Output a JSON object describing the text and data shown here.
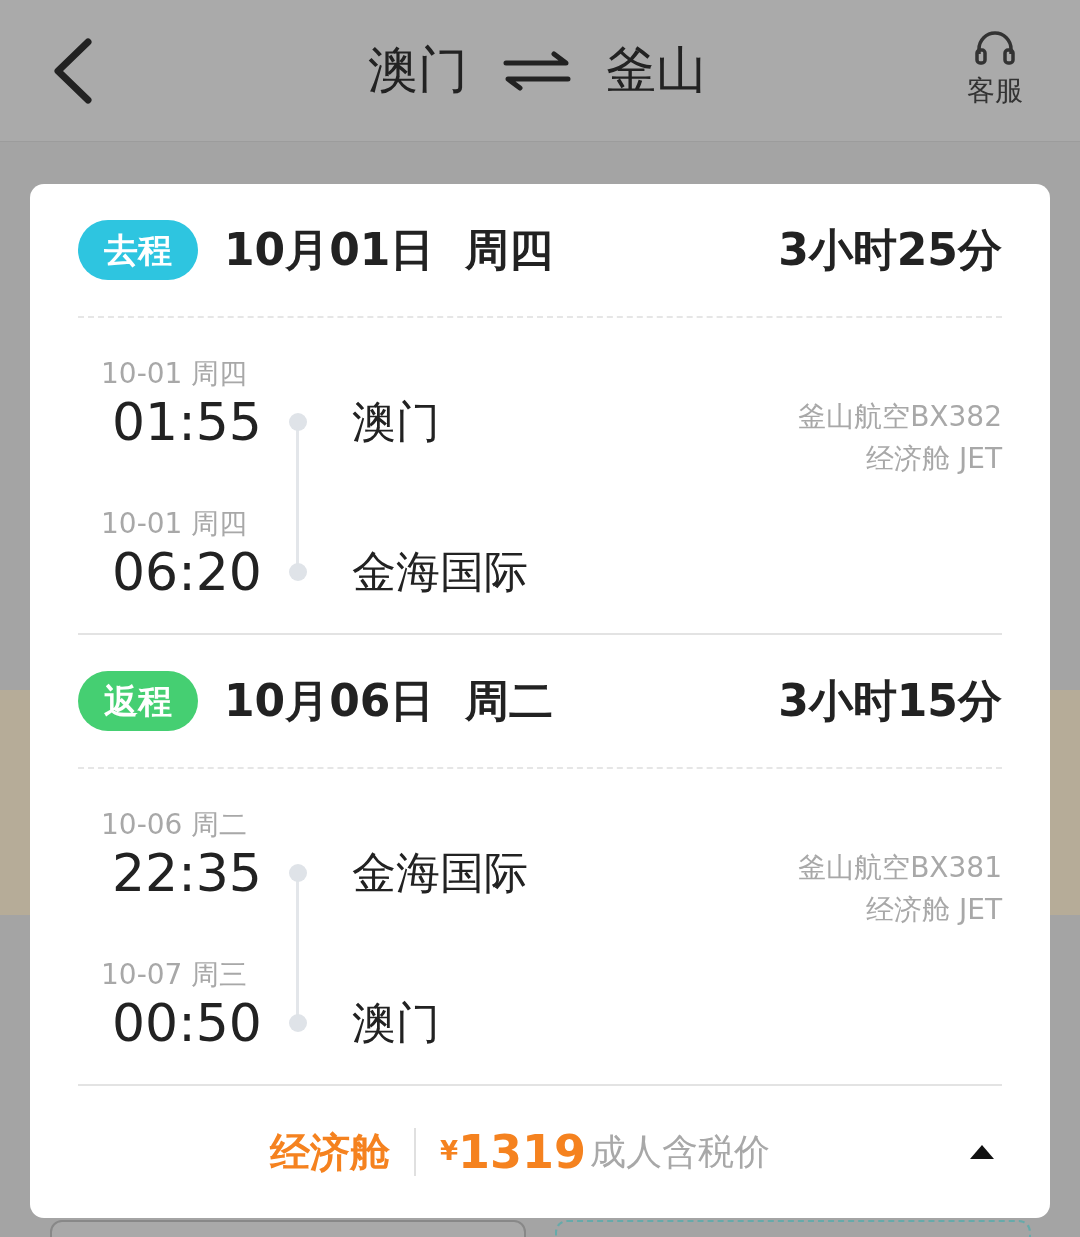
{
  "header": {
    "origin": "澳门",
    "destination": "釜山",
    "service_label": "客服"
  },
  "segments": [
    {
      "tag": "去程",
      "color": "#2ec5e0",
      "date": "10月01日  周四",
      "duration": "3小时25分",
      "flight": "釜山航空BX382",
      "cabin": "经济舱 JET",
      "stops": [
        {
          "date": "10-01 周四",
          "time": "01:55",
          "place": "澳门"
        },
        {
          "date": "10-01 周四",
          "time": "06:20",
          "place": "金海国际"
        }
      ]
    },
    {
      "tag": "返程",
      "color": "#45cf72",
      "date": "10月06日  周二",
      "duration": "3小时15分",
      "flight": "釜山航空BX381",
      "cabin": "经济舱 JET",
      "stops": [
        {
          "date": "10-06 周二",
          "time": "22:35",
          "place": "金海国际"
        },
        {
          "date": "10-07 周三",
          "time": "00:50",
          "place": "澳门"
        }
      ]
    }
  ],
  "footer": {
    "cabin_class": "经济舱",
    "currency": "¥",
    "price": "1319",
    "price_note": "成人含税价",
    "expanded": true
  }
}
